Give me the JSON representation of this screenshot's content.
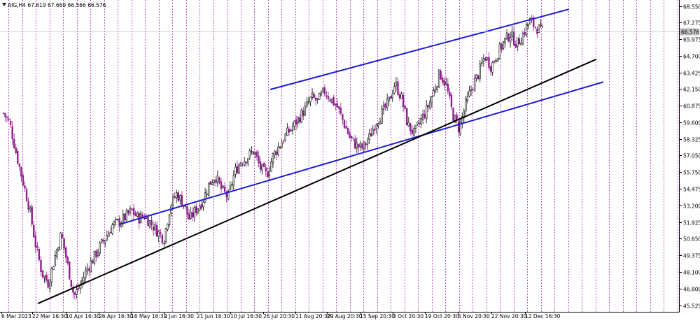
{
  "chart_data": {
    "type": "candlestick",
    "symbol_line": "AIG,H4  67.619 67.669 66.566 66.576",
    "symbol_icon": "triangle-down-icon",
    "current_price": 66.576,
    "y_ticks": [
      "68.550",
      "67.275",
      "65.975",
      "64.700",
      "63.425",
      "62.150",
      "60.875",
      "59.600",
      "58.325",
      "57.050",
      "55.750",
      "54.475",
      "53.200",
      "51.925",
      "50.650",
      "49.375",
      "48.100",
      "46.800",
      "45.525"
    ],
    "ylim": [
      45.2,
      68.9
    ],
    "x_ticks": [
      "6 Mar 2023",
      "22 Mar 16:30",
      "10 Apr 16:30",
      "26 Apr 16:30",
      "16 May 16:30",
      "2 Jun 16:30",
      "21 Jun 16:30",
      "10 Jul 16:30",
      "26 Jul 20:30",
      "11 Aug 20:30",
      "29 Aug 20:30",
      "15 Sep 20:30",
      "3 Oct 20:30",
      "19 Oct 20:30",
      "6 Nov 20:30",
      "22 Nov 20:30",
      "12 Dec 16:30"
    ],
    "close_path": [
      60.3,
      59.5,
      57.2,
      55.1,
      53.1,
      50.2,
      48.0,
      47.2,
      49.2,
      51.0,
      48.6,
      46.2,
      47.1,
      48.3,
      49.1,
      50.0,
      50.8,
      51.7,
      51.9,
      52.3,
      52.8,
      52.2,
      52.4,
      51.8,
      51.2,
      50.6,
      53.2,
      54.1,
      53.4,
      52.1,
      52.9,
      53.5,
      54.8,
      55.5,
      54.4,
      53.8,
      55.7,
      56.6,
      56.9,
      57.4,
      56.1,
      55.5,
      57.0,
      57.8,
      58.6,
      59.2,
      59.9,
      60.6,
      61.5,
      61.2,
      62.0,
      61.4,
      60.8,
      59.6,
      58.4,
      57.8,
      57.6,
      58.4,
      59.6,
      60.3,
      61.1,
      62.6,
      61.5,
      59.4,
      58.7,
      59.7,
      60.6,
      61.9,
      63.4,
      62.4,
      60.2,
      59.1,
      60.9,
      62.3,
      63.3,
      64.7,
      63.9,
      64.9,
      65.8,
      66.4,
      65.6,
      66.4,
      67.4,
      66.9,
      66.6
    ],
    "trendlines": [
      {
        "name": "upper-channel-line",
        "color": "#1d1dd6",
        "from": [
          "26 Jul 20:30",
          62.12
        ],
        "to": [
          "after 12 Dec 16:30",
          68.3
        ]
      },
      {
        "name": "lower-channel-line",
        "color": "#1d1dd6",
        "from": [
          "10 May 2023",
          51.75
        ],
        "to": [
          "after 12 Dec 16:30",
          62.7
        ]
      },
      {
        "name": "support-trendline",
        "color": "#000000",
        "from": [
          "22 Mar 16:30",
          45.65
        ],
        "to": [
          "after 12 Dec 16:30",
          64.45
        ]
      }
    ],
    "colors": {
      "bull": "#000000",
      "bear": "#8e1f8e",
      "grid": "#a82ba8",
      "line_blue": "#1d1dd6",
      "line_black": "#000000"
    }
  }
}
